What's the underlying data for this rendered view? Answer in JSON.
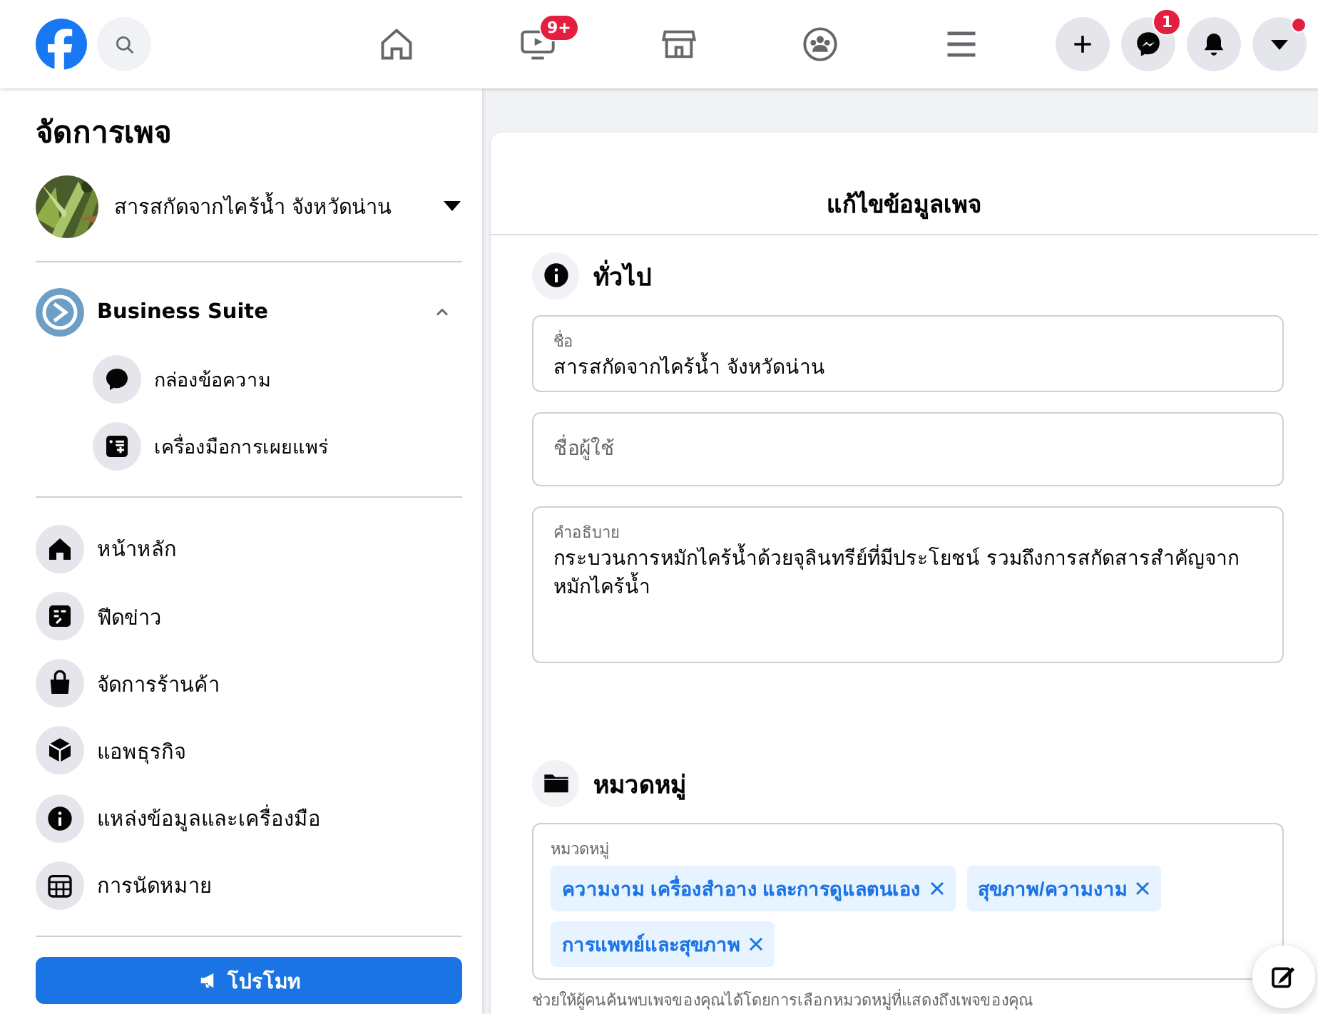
{
  "top_bar": {
    "nav_tabs": [
      {
        "kind": "home"
      },
      {
        "kind": "video",
        "badge": "9+"
      },
      {
        "kind": "store"
      },
      {
        "kind": "groups"
      },
      {
        "kind": "menu"
      }
    ],
    "actions": [
      {
        "kind": "plus"
      },
      {
        "kind": "messenger",
        "badge": "1"
      },
      {
        "kind": "bell"
      },
      {
        "kind": "caret",
        "dot": true
      }
    ]
  },
  "sidebar": {
    "title": "จัดการเพจ",
    "page": {
      "name": "สารสกัดจากไคร้น้ำ จังหวัดน่าน"
    },
    "business_suite": {
      "label": "Business Suite",
      "expanded": true,
      "children": [
        {
          "kind": "chat",
          "label": "กล่องข้อความ"
        },
        {
          "kind": "publish",
          "label": "เครื่องมือการเผยแพร่"
        }
      ]
    },
    "items": [
      {
        "kind": "home",
        "label": "หน้าหลัก"
      },
      {
        "kind": "feed",
        "label": "ฟีดข่าว"
      },
      {
        "kind": "shop",
        "label": "จัดการร้านค้า"
      },
      {
        "kind": "box",
        "label": "แอพธุรกิจ"
      },
      {
        "kind": "info",
        "label": "แหล่งข้อมูลและเครื่องมือ"
      },
      {
        "kind": "calendar",
        "label": "การนัดหมาย"
      }
    ],
    "promote_button": "โปรโมท"
  },
  "form": {
    "title": "แก้ไขข้อมูลเพจ",
    "general": {
      "heading": "ทั่วไป",
      "fields": [
        {
          "kind": "input",
          "label": "ชื่อ",
          "value": "สารสกัดจากไคร้น้ำ จังหวัดน่าน"
        },
        {
          "kind": "input",
          "placeholder": "ชื่อผู้ใช้"
        },
        {
          "kind": "textarea",
          "label": "คำอธิบาย",
          "value": "กระบวนการหมักไคร้น้ำด้วยจุลินทรีย์ที่มีประโยชน์  รวมถึงการสกัดสารสำคัญจากหมักไคร้น้ำ"
        }
      ]
    },
    "categories": {
      "heading": "หมวดหมู่",
      "label": "หมวดหมู่",
      "tags": [
        "ความงาม เครื่องสำอาง และการดูแลตนเอง",
        "สุขภาพ/ความงาม",
        "การแพทย์และสุขภาพ"
      ],
      "help": "ช่วยให้ผู้คนค้นพบเพจของคุณได้โดยการเลือกหมวดหมู่ที่แสดงถึงเพจของคุณ"
    }
  }
}
